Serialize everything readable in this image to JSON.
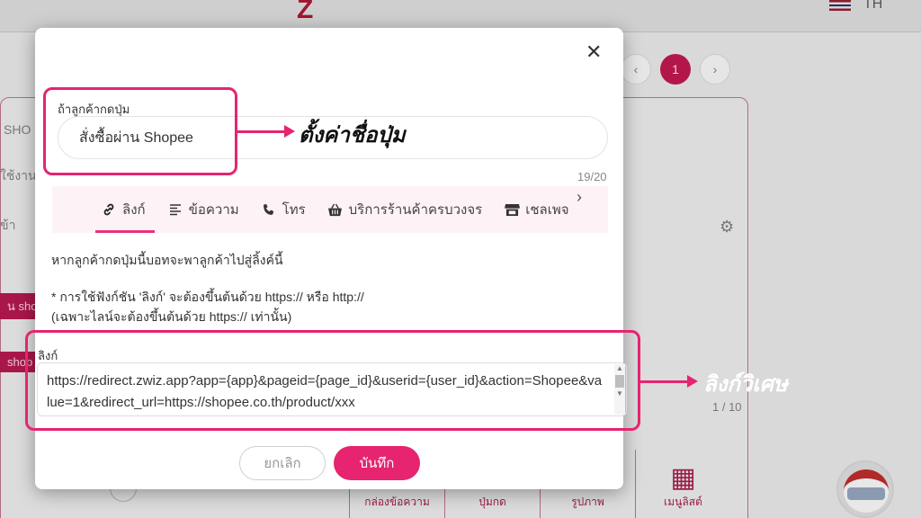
{
  "background": {
    "lang": "TH",
    "pager_current": "1",
    "pager_prev": "‹",
    "pager_next": "›",
    "left_texts": [
      "SHO",
      "ใช้งาน",
      "ข้า"
    ],
    "left_tags": [
      "น sho",
      "shop"
    ],
    "count": "1 / 10",
    "tiles": [
      "กล่องข้อความ",
      "ปุ่มกด",
      "รูปภาพ",
      "เมนูลิสต์"
    ]
  },
  "modal": {
    "close_icon": "close-icon",
    "button_name_label": "ถ้าลูกค้ากดปุ่ม",
    "button_name_value": "สั่งซื้อผ่าน Shopee",
    "char_count": "19/20",
    "tabs": [
      {
        "label": "ลิงก์",
        "icon": "link-icon",
        "active": true
      },
      {
        "label": "ข้อความ",
        "icon": "text-lines-icon",
        "active": false
      },
      {
        "label": "โทร",
        "icon": "phone-icon",
        "active": false
      },
      {
        "label": "บริการร้านค้าครบวงจร",
        "icon": "basket-icon",
        "active": false
      },
      {
        "label": "เชลเพจ",
        "icon": "store-icon",
        "active": false
      }
    ],
    "info_line": "หากลูกค้ากดปุ่มนี้บอทจะพาลูกค้าไปสู่ลิ้งค์นี้",
    "note_line1": "* การใช้ฟังก์ชัน 'ลิงก์' จะต้องขึ้นต้นด้วย https:// หรือ http://",
    "note_line2": "(เฉพาะไลน์จะต้องขึ้นต้นด้วย https:// เท่านั้น)",
    "link_label": "ลิงก์",
    "link_value": "https://redirect.zwiz.app?app={app}&pageid={page_id}&userid={user_id}&action=Shopee&value=1&redirect_url=https://shopee.co.th/product/xxx",
    "cancel_label": "ยกเลิก",
    "save_label": "บันทึก"
  },
  "annotations": {
    "button_name_note": "ตั้งค่าชื่อปุ่ม",
    "link_note": "ลิงก์วิเศษ",
    "accent_color": "#e6246f"
  }
}
